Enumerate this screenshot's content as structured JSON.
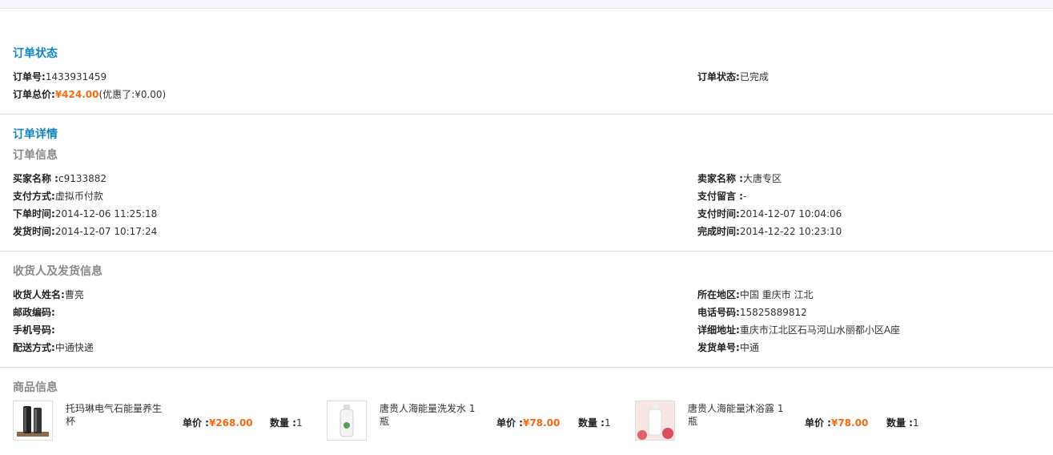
{
  "status_section": {
    "title": "订单状态",
    "order_no_label": "订单号:",
    "order_no": "1433931459",
    "total_label": "订单总价:",
    "total_price": "¥424.00",
    "discount": "(优惠了:¥0.00)",
    "state_label": "订单状态:",
    "state_value": "已完成"
  },
  "detail_section": {
    "title": "订单详情",
    "subtitle": "订单信息",
    "buyer_label": "买家名称 :",
    "buyer_value": "c9133882",
    "seller_label": "卖家名称 :",
    "seller_value": "大唐专区",
    "pay_method_label": "支付方式:",
    "pay_method_value": "虚拟币付款",
    "pay_note_label": "支付留言 :",
    "pay_note_value": "-",
    "order_time_label": "下单时间:",
    "order_time_value": "2014-12-06 11:25:18",
    "pay_time_label": "支付时间:",
    "pay_time_value": "2014-12-07 10:04:06",
    "ship_time_label": "发货时间:",
    "ship_time_value": "2014-12-07 10:17:24",
    "done_time_label": "完成时间:",
    "done_time_value": "2014-12-22 10:23:10"
  },
  "shipping_section": {
    "title": "收货人及发货信息",
    "receiver_label": "收货人姓名:",
    "receiver_value": "曹亮",
    "region_label": "所在地区:",
    "region_value": "中国  重庆市  江北",
    "postcode_label": "邮政编码:",
    "postcode_value": "",
    "phone_label": "电话号码:",
    "phone_value": "15825889812",
    "mobile_label": "手机号码:",
    "mobile_value": "",
    "address_label": "详细地址:",
    "address_value": "重庆市江北区石马河山水丽都小区A座",
    "delivery_label": "配送方式:",
    "delivery_value": "中通快递",
    "tracking_label": "发货单号:",
    "tracking_value": "中通"
  },
  "products_section": {
    "title": "商品信息",
    "items": [
      {
        "name": "托玛琳电气石能量养生杯",
        "price_label": "单价 :",
        "price": "¥268.00",
        "qty_label": "数量 :",
        "qty": "1"
      },
      {
        "name": "唐贵人海能量洗发水 1瓶",
        "price_label": "单价 :",
        "price": "¥78.00",
        "qty_label": "数量 :",
        "qty": "1"
      },
      {
        "name": "唐贵人海能量沐浴露 1瓶",
        "price_label": "单价 :",
        "price": "¥78.00",
        "qty_label": "数量 :",
        "qty": "1"
      }
    ]
  }
}
